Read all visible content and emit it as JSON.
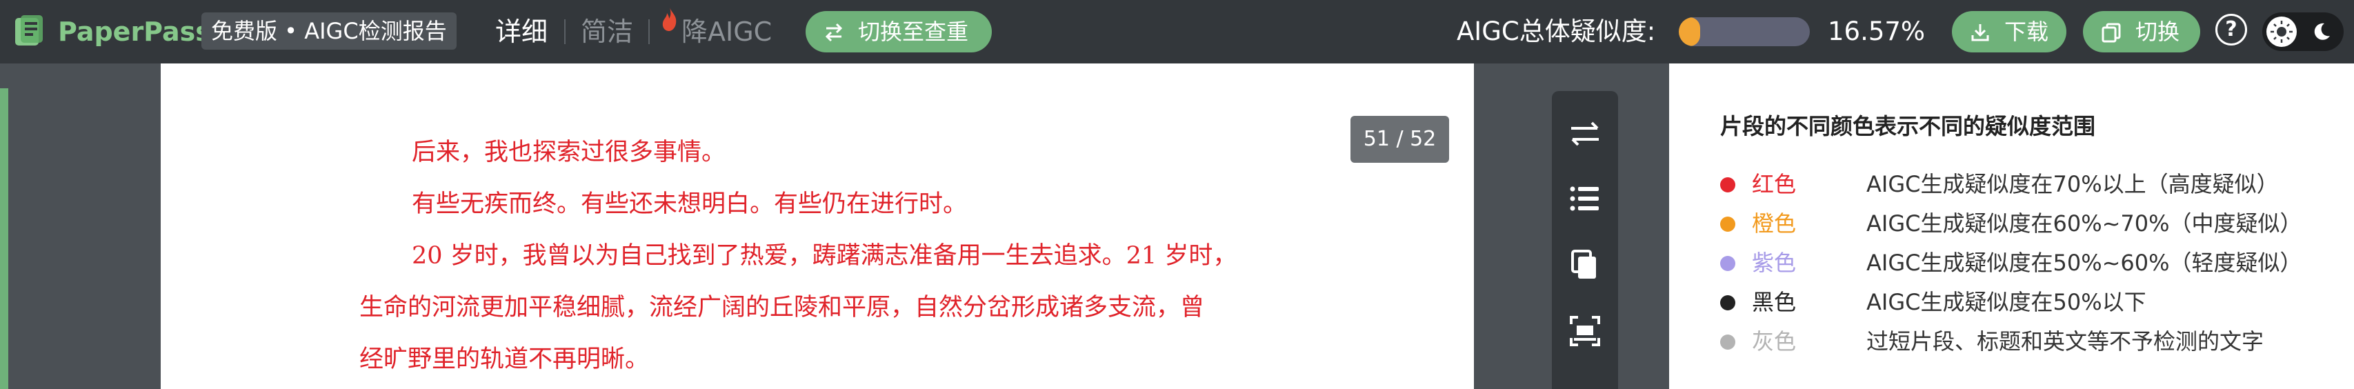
{
  "header": {
    "brand": "PaperPass",
    "edition": "免费版 • AIGC检测报告",
    "tabs": [
      {
        "label": "详细",
        "active": true
      },
      {
        "label": "简洁",
        "active": false
      },
      {
        "label": "降AIGC",
        "active": false
      }
    ],
    "switch_button": "切换至查重",
    "score_label": "AIGC总体疑似度:",
    "score_value": "16.57%",
    "score_fraction": 0.1657,
    "download_button": "下载",
    "switch_small_button": "切换",
    "help_label": "?"
  },
  "document": {
    "page_indicator": "51 / 52",
    "lines": [
      "后来，我也探索过很多事情。",
      "有些无疾而终。有些还未想明白。有些仍在进行时。",
      "20 岁时，我曾以为自己找到了热爱，踌躇满志准备用一生去追求。21 岁时，",
      "生命的河流更加平稳细腻，流经广阔的丘陵和平原，自然分岔形成诸多支流，曾",
      "经旷野里的轨道不再明晰。"
    ],
    "text_color": "#e0232a"
  },
  "tools": [
    "swap-icon",
    "list-icon",
    "copy-icon",
    "scan-icon"
  ],
  "legend": {
    "title": "片段的不同颜色表示不同的疑似度范围",
    "items": [
      {
        "color_name": "红色",
        "description": "AIGC生成疑似度在70%以上（高度疑似）",
        "hex": "#e5262e"
      },
      {
        "color_name": "橙色",
        "description": "AIGC生成疑似度在60%~70%（中度疑似）",
        "hex": "#f29a1e"
      },
      {
        "color_name": "紫色",
        "description": "AIGC生成疑似度在50%~60%（轻度疑似）",
        "hex": "#a79be8"
      },
      {
        "color_name": "黑色",
        "description": "AIGC生成疑似度在50%以下",
        "hex": "#222222"
      },
      {
        "color_name": "灰色",
        "description": "过短片段、标题和英文等不予检测的文字",
        "hex": "#b3b3b3"
      }
    ]
  },
  "colors": {
    "accent_green": "#6fb27a",
    "topbar": "#33373b",
    "score_fill": "#f2a534"
  }
}
